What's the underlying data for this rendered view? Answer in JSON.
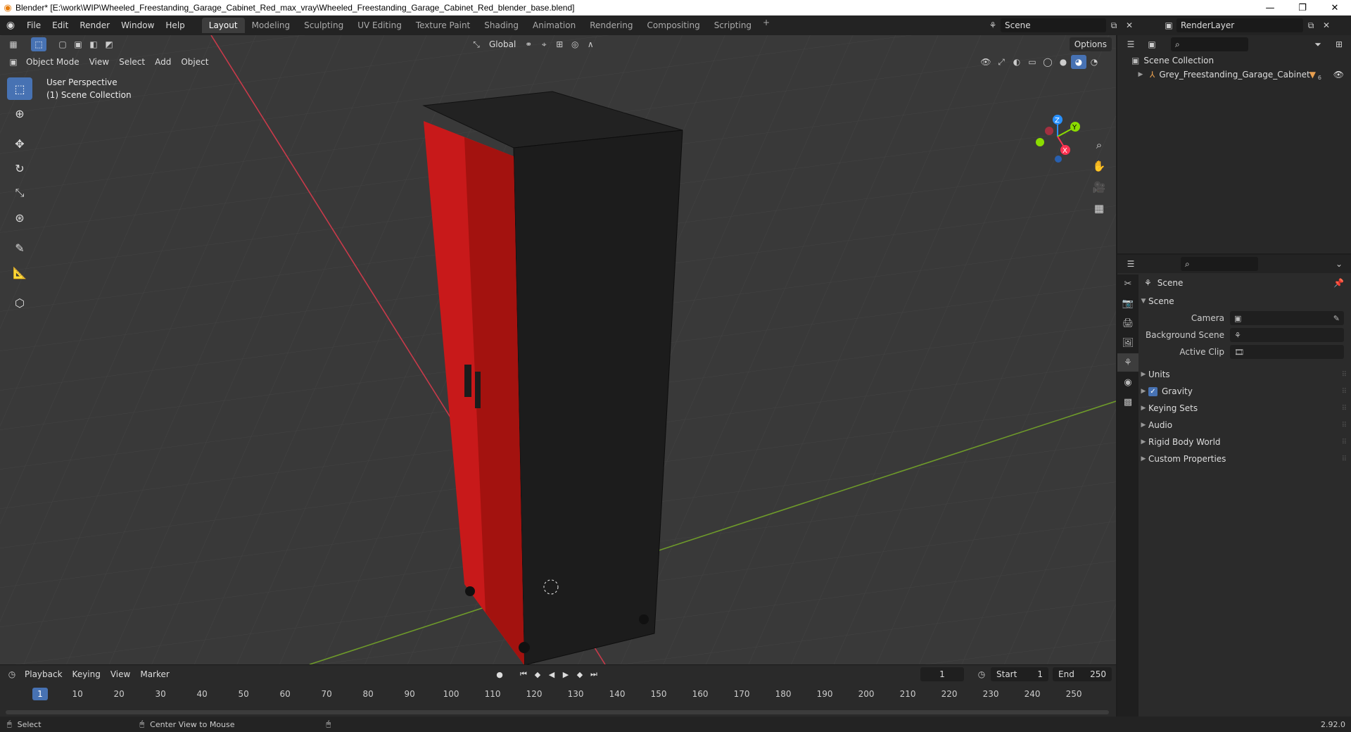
{
  "window": {
    "title": "Blender* [E:\\work\\WIP\\Wheeled_Freestanding_Garage_Cabinet_Red_max_vray\\Wheeled_Freestanding_Garage_Cabinet_Red_blender_base.blend]",
    "minimize": "—",
    "restore": "❐",
    "close": "✕"
  },
  "menu": [
    "File",
    "Edit",
    "Render",
    "Window",
    "Help"
  ],
  "workspaces": [
    "Layout",
    "Modeling",
    "Sculpting",
    "UV Editing",
    "Texture Paint",
    "Shading",
    "Animation",
    "Rendering",
    "Compositing",
    "Scripting"
  ],
  "active_workspace": "Layout",
  "scene_name": "Scene",
  "render_layer": "RenderLayer",
  "viewport": {
    "transform_orientation": "Global",
    "options_label": "Options",
    "mode": "Object Mode",
    "menus": [
      "View",
      "Select",
      "Add",
      "Object"
    ],
    "perspective_label": "User Perspective",
    "collection_label": "(1) Scene Collection",
    "gizmo_axes": {
      "x": "X",
      "y": "Y",
      "z": "Z"
    },
    "colors": {
      "x_axis": "#ff3352",
      "y_axis": "#8bdc00",
      "z_axis": "#2890ff",
      "cabinet_red": "#c8191a",
      "cabinet_dark": "#1c1c1c"
    }
  },
  "timeline": {
    "menus": [
      "Playback",
      "Keying",
      "View",
      "Marker"
    ],
    "current_frame": "1",
    "start_label": "Start",
    "start": "1",
    "end_label": "End",
    "end": "250",
    "ruler": [
      "10",
      "20",
      "30",
      "40",
      "50",
      "60",
      "70",
      "80",
      "90",
      "100",
      "110",
      "120",
      "130",
      "140",
      "150",
      "160",
      "170",
      "180",
      "190",
      "200",
      "210",
      "220",
      "230",
      "240",
      "250"
    ],
    "playhead": "1"
  },
  "status": {
    "select": "Select",
    "center_view": "Center View to Mouse",
    "version": "2.92.0"
  },
  "outliner": {
    "root": "Scene Collection",
    "items": [
      {
        "name": "Grey_Freestanding_Garage_Cabinet",
        "badge": "6"
      }
    ]
  },
  "properties": {
    "context": "Scene",
    "panel": "Scene",
    "fields": [
      {
        "label": "Camera"
      },
      {
        "label": "Background Scene"
      },
      {
        "label": "Active Clip"
      }
    ],
    "subpanels": [
      "Units",
      "Gravity",
      "Keying Sets",
      "Audio",
      "Rigid Body World",
      "Custom Properties"
    ]
  }
}
